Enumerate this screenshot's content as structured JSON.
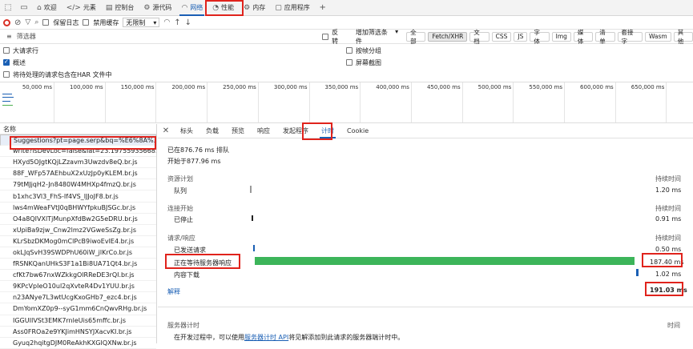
{
  "tabs": {
    "welcome": "欢迎",
    "elements": "元素",
    "console": "控制台",
    "sources": "源代码",
    "network": "网络",
    "performance": "性能",
    "memory": "内存",
    "application": "应用程序"
  },
  "toolbar": {
    "preserve_log": "保留日志",
    "disable_cache": "禁用缓存",
    "throttle": "无限制"
  },
  "filter": {
    "placeholder": "筛选器",
    "invert": "反转",
    "more_filters": "增加筛选条件",
    "types": [
      "全部",
      "Fetch/XHR",
      "文档",
      "CSS",
      "JS",
      "字体",
      "Img",
      "媒体",
      "清单",
      "套接字",
      "Wasm",
      "其他"
    ]
  },
  "options": {
    "big_rows": "大请求行",
    "overview": "概述",
    "har": "将待处理的请求包含在HAR 文件中",
    "group_by_frame": "按帧分组",
    "screenshots": "屏幕截图"
  },
  "overview_ticks": [
    "50,000 ms",
    "100,000 ms",
    "150,000 ms",
    "200,000 ms",
    "250,000 ms",
    "300,000 ms",
    "350,000 ms",
    "400,000 ms",
    "450,000 ms",
    "500,000 ms",
    "550,000 ms",
    "600,000 ms",
    "650,000 ms"
  ],
  "requests": {
    "header": "名称",
    "items": [
      "Suggestions?pt=page.serp&bq=%E6%8A%...",
      "write?isDevLoc=false&lat=23.19755935668...",
      "HXyd5OJgtKQjLZzavm3Uwzdv8eQ.br.js",
      "88F_WFp57AEhbuX2xUzJp0yKLEM.br.js",
      "79tMJjqH2-Jn8480W4MHXp4fmzQ.br.js",
      "b1xhc3Vl3_FhS-If4VS_IJJoJF8.br.js",
      "lws4mWeaFVtJ0qBHWYfpkuBJSGc.br.js",
      "O4a8QIVXlTjMunpXfdBw2G5eDRU.br.js",
      "xUpiBa9zjw_Cnw2lmz2VGweSsZg.br.js",
      "KLrSbzDKMog0mClPcB9iwoEvIE4.br.js",
      "okLJqSvH39SWDPhU60iW_jlKrCo.br.js",
      "fRSNKQanUHkS3F1a1Bi8UA71Qt4.br.js",
      "cfKt7bw67nxWZkkgOlRReDE3rQI.br.js",
      "9KPcVpIeO10ul2qXvteR4Dv1YUU.br.js",
      "n23ANye7L3wtUcgKxoGHb7_ezc4.br.js",
      "DmYomXZ0p9--syG1mm6CnQwvRHg.br.js",
      "IGGUIIVSt3EMK7rnleUis65mffc.br.js",
      "Ass0FROa2e9YKJimHNSYJXacvKI.br.js",
      "Gyuq2hqitgDJM0ReAkhKXGIQXNw.br.js"
    ]
  },
  "detail_tabs": [
    "标头",
    "负载",
    "预览",
    "响应",
    "发起程序",
    "计时",
    "Cookie"
  ],
  "timing": {
    "queued_at": "已在876.76 ms 排队",
    "started_at": "开始于877.96 ms",
    "resource_scheduling": "资源计划",
    "duration_label": "持续时间",
    "queueing": "队列",
    "queueing_val": "1.20 ms",
    "connection_start": "连接开始",
    "stalled": "已停止",
    "stalled_val": "0.91 ms",
    "request_response": "请求/响应",
    "request_sent": "已发送请求",
    "request_sent_val": "0.50 ms",
    "waiting": "正在等待服务器响应",
    "waiting_val": "187.40 ms",
    "download": "内容下载",
    "download_val": "1.02 ms",
    "explanation": "解释",
    "total": "191.03 ms",
    "server_timing": "服务器计时",
    "time_label": "时间",
    "server_note_pre": "在开发过程中，可以使用",
    "server_note_link": "服务器计时 API",
    "server_note_post": "将见解添加到此请求的服务器端计时中。"
  },
  "colors": {
    "accent": "#1a5fb4",
    "highlight": "#e0231c",
    "waiting_bar": "#3cb55a"
  }
}
